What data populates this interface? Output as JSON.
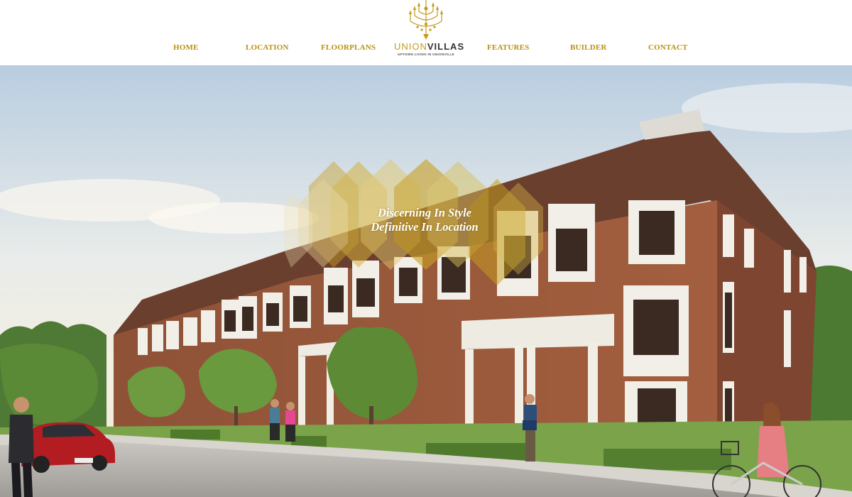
{
  "colors": {
    "gold": "#c59a1b",
    "nav_text": "#b8920f"
  },
  "nav": {
    "items": [
      {
        "label": "HOME"
      },
      {
        "label": "LOCATION"
      },
      {
        "label": "FLOORPLANS"
      },
      {
        "label": "FEATURES"
      },
      {
        "label": "BUILDER"
      },
      {
        "label": "CONTACT"
      }
    ]
  },
  "logo": {
    "icon": "chandelier-icon",
    "word_part1": "UNION",
    "word_part2": "VILLAS",
    "tagline": "UPTOWN LIVING IN UNIONVILLE"
  },
  "hero": {
    "line1": "Discerning In Style",
    "line2": "Definitive In Location",
    "image": "townhouse-rendering"
  }
}
